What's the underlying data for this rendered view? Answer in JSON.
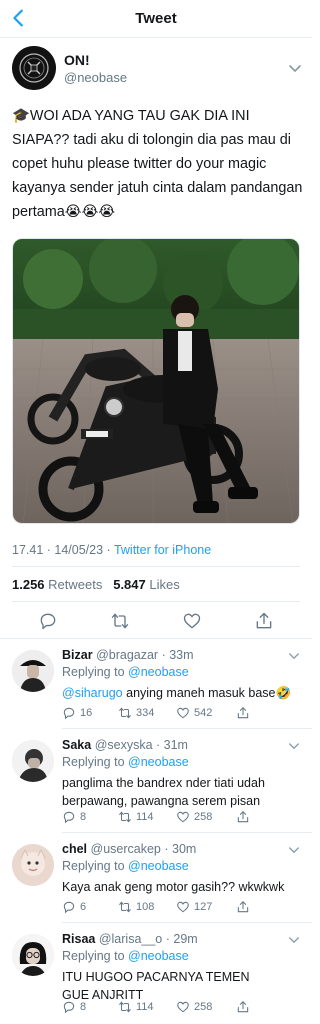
{
  "header": {
    "title": "Tweet",
    "back_icon": "chevron-left-icon"
  },
  "tweet": {
    "author_name": "ON!",
    "author_handle": "@neobase",
    "text": "🎓WOI ADA YANG TAU GAK DIA INI SIAPA?? tadi aku di tolongin dia pas mau di copet huhu please twitter do your magic kayanya sender jatuh cinta dalam pandangan pertama😭😭😭",
    "timestamp": "17.41 · 14/05/23 · ",
    "source": "Twitter for iPhone",
    "retweets_count": "1.256",
    "retweets_label": "Retweets",
    "likes_count": "5.847",
    "likes_label": "Likes"
  },
  "replies": [
    {
      "name": "Bizar",
      "handle": "@bragazar",
      "time": "· 33m",
      "replying_label": "Replying to",
      "replying_to": "@neobase",
      "mention": "@siharugo",
      "text": " anying maneh masuk base🤣",
      "replies": "16",
      "retweets": "334",
      "likes": "542"
    },
    {
      "name": "Saka",
      "handle": "@sexyska",
      "time": "· 31m",
      "replying_label": "Replying to",
      "replying_to": "@neobase",
      "mention": "",
      "text": "panglima the bandrex nder tiati udah berpawang, pawangna serem pisan",
      "replies": "8",
      "retweets": "114",
      "likes": "258"
    },
    {
      "name": "chel",
      "handle": "@usercakep",
      "time": "· 30m",
      "replying_label": "Replying to",
      "replying_to": "@neobase",
      "mention": "",
      "text": "Kaya anak geng motor gasih?? wkwkwk",
      "replies": "6",
      "retweets": "108",
      "likes": "127"
    },
    {
      "name": "Risaa",
      "handle": "@larisa__o",
      "time": "· 29m",
      "replying_label": "Replying to",
      "replying_to": "@neobase",
      "mention": "",
      "text": "ITU HUGOO PACARNYA TEMEN GUE ANJRITT",
      "replies": "8",
      "retweets": "114",
      "likes": "258"
    }
  ],
  "colors": {
    "accent": "#1da1f2",
    "muted": "#657786",
    "divider": "#e6ecf0"
  }
}
